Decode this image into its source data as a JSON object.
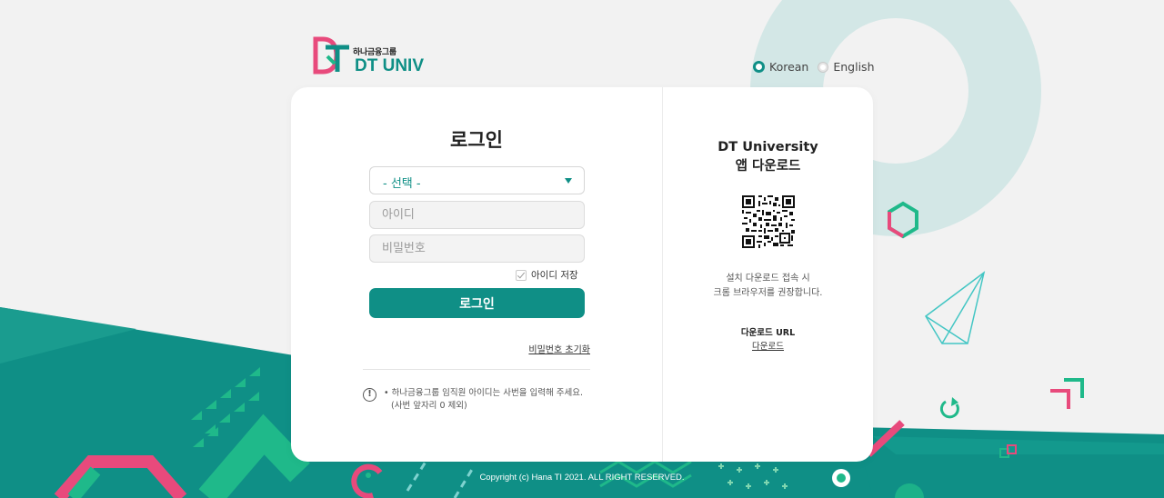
{
  "logo": {
    "group_name": "하나금융그룹",
    "brand": "DT UNIV"
  },
  "language": {
    "options": [
      {
        "label": "Korean",
        "selected": true
      },
      {
        "label": "English",
        "selected": false
      }
    ]
  },
  "login": {
    "title": "로그인",
    "select_value": "- 선택 -",
    "id_placeholder": "아이디",
    "password_placeholder": "비밀번호",
    "save_id_label": "아이디 저장",
    "save_id_checked": true,
    "login_button": "로그인",
    "reset_password_link": "비밀번호 초기화",
    "notice_line1": "• 하나금융그룹 임직원 아이디는 사번을 입력해 주세요.",
    "notice_line2": "(사번 앞자리 0 제외)"
  },
  "app": {
    "title_line1": "DT University",
    "title_line2": "앱 다운로드",
    "desc_line1": "설치 다운로드 접속 시",
    "desc_line2": "크롬 브라우저를 권장합니다.",
    "url_label": "다운로드 URL",
    "url_link": "다운로드"
  },
  "footer": {
    "copyright": "Copyright (c) Hana TI 2021. ALL RIGHT RESERVED."
  },
  "colors": {
    "brand_teal": "#0f8f86",
    "accent_pink": "#e84a7c",
    "accent_green": "#1fb98a",
    "soft_teal": "#d3e7e6"
  }
}
